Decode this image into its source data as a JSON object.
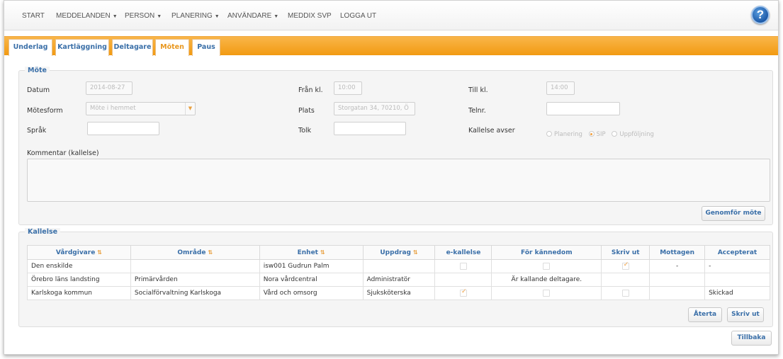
{
  "nav": {
    "items": [
      {
        "label": "START",
        "caret": false
      },
      {
        "label": "MEDDELANDEN",
        "caret": true
      },
      {
        "label": "PERSON",
        "caret": true
      },
      {
        "label": "PLANERING",
        "caret": true
      },
      {
        "label": "ANVÄNDARE",
        "caret": true
      },
      {
        "label": "MEDDIX SVP",
        "caret": false
      },
      {
        "label": "LOGGA UT",
        "caret": false
      }
    ],
    "help": "?"
  },
  "tabs": [
    {
      "label": "Underlag",
      "active": false
    },
    {
      "label": "Kartläggning",
      "active": false
    },
    {
      "label": "Deltagare",
      "active": false
    },
    {
      "label": "Möten",
      "active": true
    },
    {
      "label": "Paus",
      "active": false
    }
  ],
  "mote": {
    "legend": "Möte",
    "datum_label": "Datum",
    "datum_value": "2014-08-27",
    "fran_label": "Från kl.",
    "fran_value": "10:00",
    "till_label": "Till kl.",
    "till_value": "14:00",
    "motesform_label": "Mötesform",
    "motesform_value": "Möte i hemmet",
    "plats_label": "Plats",
    "plats_value": "Storgatan 34, 70210, Ö",
    "telnr_label": "Telnr.",
    "telnr_value": "",
    "sprak_label": "Språk",
    "sprak_value": "",
    "tolk_label": "Tolk",
    "tolk_value": "",
    "kallelse_avser_label": "Kallelse avser",
    "radio_options": [
      {
        "label": "Planering",
        "selected": false
      },
      {
        "label": "SIP",
        "selected": true
      },
      {
        "label": "Uppföljning",
        "selected": false
      }
    ],
    "kommentar_label": "Kommentar (kallelse)",
    "kommentar_value": "",
    "genomfor_button": "Genomför möte"
  },
  "kallelse": {
    "legend": "Kallelse",
    "columns": [
      "Vårdgivare",
      "Område",
      "Enhet",
      "Uppdrag",
      "e-kallelse",
      "För kännedom",
      "Skriv ut",
      "Mottagen",
      "Accepterat"
    ],
    "sortable": [
      true,
      true,
      true,
      true,
      false,
      false,
      false,
      false,
      false
    ],
    "rows": [
      {
        "vardgivare": "Den enskilde",
        "omrade": "",
        "enhet": "isw001 Gudrun Palm",
        "uppdrag": "",
        "ekallelse": "box",
        "kannedom": "box",
        "skrivut": "checked",
        "mottagen": "-",
        "accepterat": "-"
      },
      {
        "vardgivare": "Örebro läns landsting",
        "omrade": "Primärvården",
        "enhet": "Nora vårdcentral",
        "uppdrag": "Administratör",
        "ekallelse": "none",
        "kannedom": "Är kallande deltagare.",
        "skrivut": "none",
        "mottagen": "",
        "accepterat": ""
      },
      {
        "vardgivare": "Karlskoga kommun",
        "omrade": "Socialförvaltning Karlskoga",
        "enhet": "Vård och omsorg",
        "uppdrag": "Sjuksköterska",
        "ekallelse": "checked",
        "kannedom": "box",
        "skrivut": "box",
        "mottagen": "",
        "accepterat": "Skickad"
      }
    ],
    "aterta_button": "Återta",
    "skrivut_button": "Skriv ut"
  },
  "tillbaka_button": "Tillbaka",
  "colors": {
    "accent": "#f29a12",
    "link": "#3a6fa8",
    "check": "#f0a040"
  }
}
